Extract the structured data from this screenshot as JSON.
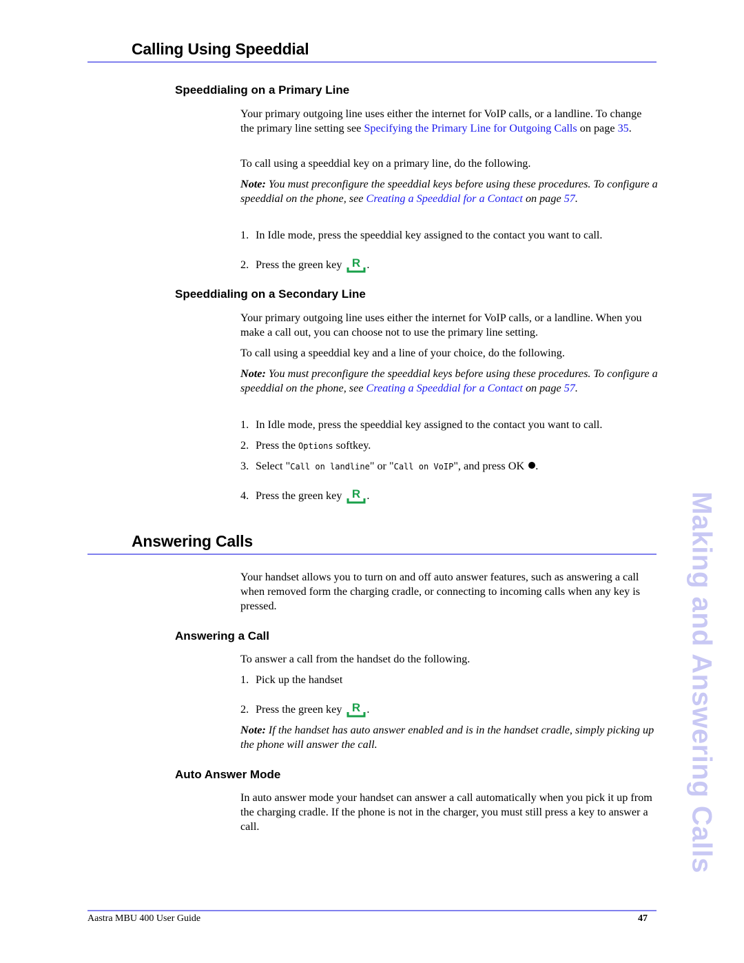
{
  "side_tab": "Making and Answering Calls",
  "colors": {
    "rule": "#8080ee",
    "link": "#1a1aee",
    "green_key": "#19a04a",
    "side_tab": "#c8c8f4"
  },
  "sections": {
    "speeddial": {
      "title": "Calling Using Speeddial",
      "primary": {
        "heading": "Speeddialing on a Primary Line",
        "intro_pre": "Your primary outgoing line uses either the internet for VoIP calls, or a landline. To change the primary line setting see ",
        "intro_link": "Specifying the Primary Line for Outgoing Calls",
        "intro_mid": " on page ",
        "intro_page_link": "35",
        "intro_post": ".",
        "instruction": "To call using a speeddial key on a primary line, do the following.",
        "note_label": "Note:",
        "note_pre": " You must preconfigure the speeddial keys before using these procedures. To configure a speeddial on the phone, see ",
        "note_link": "Creating a Speeddial for a Contact",
        "note_mid": " on page ",
        "note_page_link": "57",
        "note_post": ".",
        "steps": [
          {
            "num": "1.",
            "text": "In Idle mode, press the speeddial key assigned to the contact you want to call."
          },
          {
            "num": "2.",
            "text": "Press the green key",
            "icon": "green-key-icon",
            "post": "."
          }
        ]
      },
      "secondary": {
        "heading": "Speeddialing on a Secondary Line",
        "intro": "Your primary outgoing line uses either the internet for VoIP calls, or a landline. When you make a call out, you can choose not to use the primary line setting.",
        "instruction": "To call using a speeddial key and a line of your choice, do the following.",
        "note_label": "Note:",
        "note_pre": " You must preconfigure the speeddial keys before using these procedures. To configure a speeddial on the phone, see ",
        "note_link": "Creating a Speeddial for a Contact",
        "note_mid": " on page ",
        "note_page_link": "57",
        "note_post": ".",
        "steps": [
          {
            "num": "1.",
            "text": "In Idle mode, press the speeddial key assigned to the contact you want to call."
          },
          {
            "num": "2.",
            "pre": "Press the ",
            "mono": "Options",
            "post": " softkey."
          },
          {
            "num": "3.",
            "pre": "Select \"",
            "mono1": "Call on landline",
            "mid": "\" or \"",
            "mono2": "Call on VoIP",
            "post": "\", and press OK",
            "icon": "ok-button-icon",
            "end": "."
          },
          {
            "num": "4.",
            "text": "Press the green key",
            "icon": "green-key-icon",
            "post": "."
          }
        ]
      }
    },
    "answering": {
      "title": "Answering Calls",
      "intro": "Your handset allows you to turn on and off auto answer features, such as answering a call when removed form the charging cradle, or connecting to incoming calls when any key is pressed.",
      "answer_call": {
        "heading": "Answering a Call",
        "instruction": "To answer a call from the handset do the following.",
        "steps": [
          {
            "num": "1.",
            "text": "Pick up the handset"
          },
          {
            "num": "2.",
            "text": "Press the green key",
            "icon": "green-key-icon",
            "post": "."
          }
        ],
        "note_label": "Note:",
        "note_text": " If the handset has auto answer enabled and is in the handset cradle, simply picking up the phone will answer the call."
      },
      "auto_answer": {
        "heading": "Auto Answer Mode",
        "text": "In auto answer mode your handset can answer a call automatically when you pick it up from the charging cradle. If the phone is not in the charger, you must still press a key to answer a call."
      }
    }
  },
  "footer": {
    "guide_title": "Aastra MBU 400 User Guide",
    "page_number": "47"
  }
}
